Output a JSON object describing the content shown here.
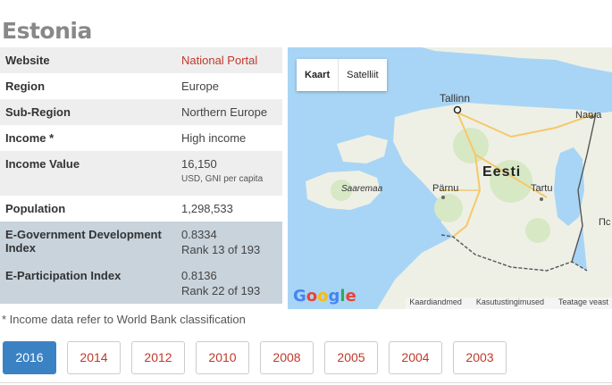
{
  "country": "Estonia",
  "rows": [
    {
      "key": "Website",
      "value": "National Portal"
    },
    {
      "key": "Region",
      "value": "Europe"
    },
    {
      "key": "Sub-Region",
      "value": "Northern Europe"
    },
    {
      "key": "Income *",
      "value": "High income"
    },
    {
      "key": "Income Value",
      "value": "16,150",
      "sub": "USD, GNI per capita"
    },
    {
      "key": "Population",
      "value": "1,298,533"
    },
    {
      "key": "E-Government Development Index",
      "value": "0.8334",
      "rank": "Rank 13 of 193"
    },
    {
      "key": "E-Participation Index",
      "value": "0.8136",
      "rank": "Rank 22 of 193"
    }
  ],
  "footnote": "* Income data refer to World Bank classification",
  "map": {
    "type_buttons": [
      "Kaart",
      "Satelliit"
    ],
    "country_label": "Eesti",
    "cities": [
      "Tallinn",
      "Narva",
      "Pärnu",
      "Tartu",
      "Пс"
    ],
    "island": "Saaremaa",
    "google_letters": [
      "G",
      "o",
      "o",
      "g",
      "l",
      "e"
    ],
    "attribution": [
      "Kaardiandmed",
      "Kasutustingimused",
      "Teatage veast"
    ],
    "colors": {
      "sea": "#a8d5f5",
      "land": "#eef0e6",
      "forest": "#d7e8c4",
      "border": "#555555",
      "road": "#f6c86a"
    }
  },
  "years": [
    "2016",
    "2014",
    "2012",
    "2010",
    "2008",
    "2005",
    "2004",
    "2003"
  ],
  "active_year": "2016"
}
